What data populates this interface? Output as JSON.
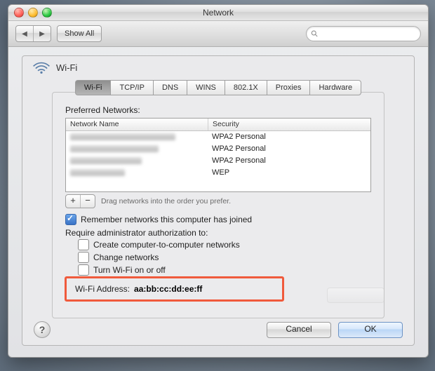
{
  "window": {
    "title": "Network"
  },
  "toolbar": {
    "back_label": "◀",
    "fwd_label": "▶",
    "showall_label": "Show All",
    "search_placeholder": ""
  },
  "sheet": {
    "title": "Wi-Fi",
    "tabs": [
      "Wi-Fi",
      "TCP/IP",
      "DNS",
      "WINS",
      "802.1X",
      "Proxies",
      "Hardware"
    ],
    "active_tab": 0,
    "preferred_networks_label": "Preferred Networks:",
    "columns": {
      "name": "Network Name",
      "security": "Security"
    },
    "networks": [
      {
        "name": "",
        "security": "WPA2 Personal"
      },
      {
        "name": "",
        "security": "WPA2 Personal"
      },
      {
        "name": "",
        "security": "WPA2 Personal"
      },
      {
        "name": "",
        "security": "WEP"
      }
    ],
    "drag_hint": "Drag networks into the order you prefer.",
    "remember_label": "Remember networks this computer has joined",
    "remember_checked": true,
    "require_label": "Require administrator authorization to:",
    "require_opts": [
      {
        "label": "Create computer-to-computer networks",
        "checked": false
      },
      {
        "label": "Change networks",
        "checked": false
      },
      {
        "label": "Turn Wi-Fi on or off",
        "checked": false
      }
    ],
    "wifi_addr_label": "Wi-Fi Address:",
    "wifi_addr_value": "aa:bb:cc:dd:ee:ff"
  },
  "footer": {
    "help": "?",
    "cancel": "Cancel",
    "ok": "OK"
  }
}
